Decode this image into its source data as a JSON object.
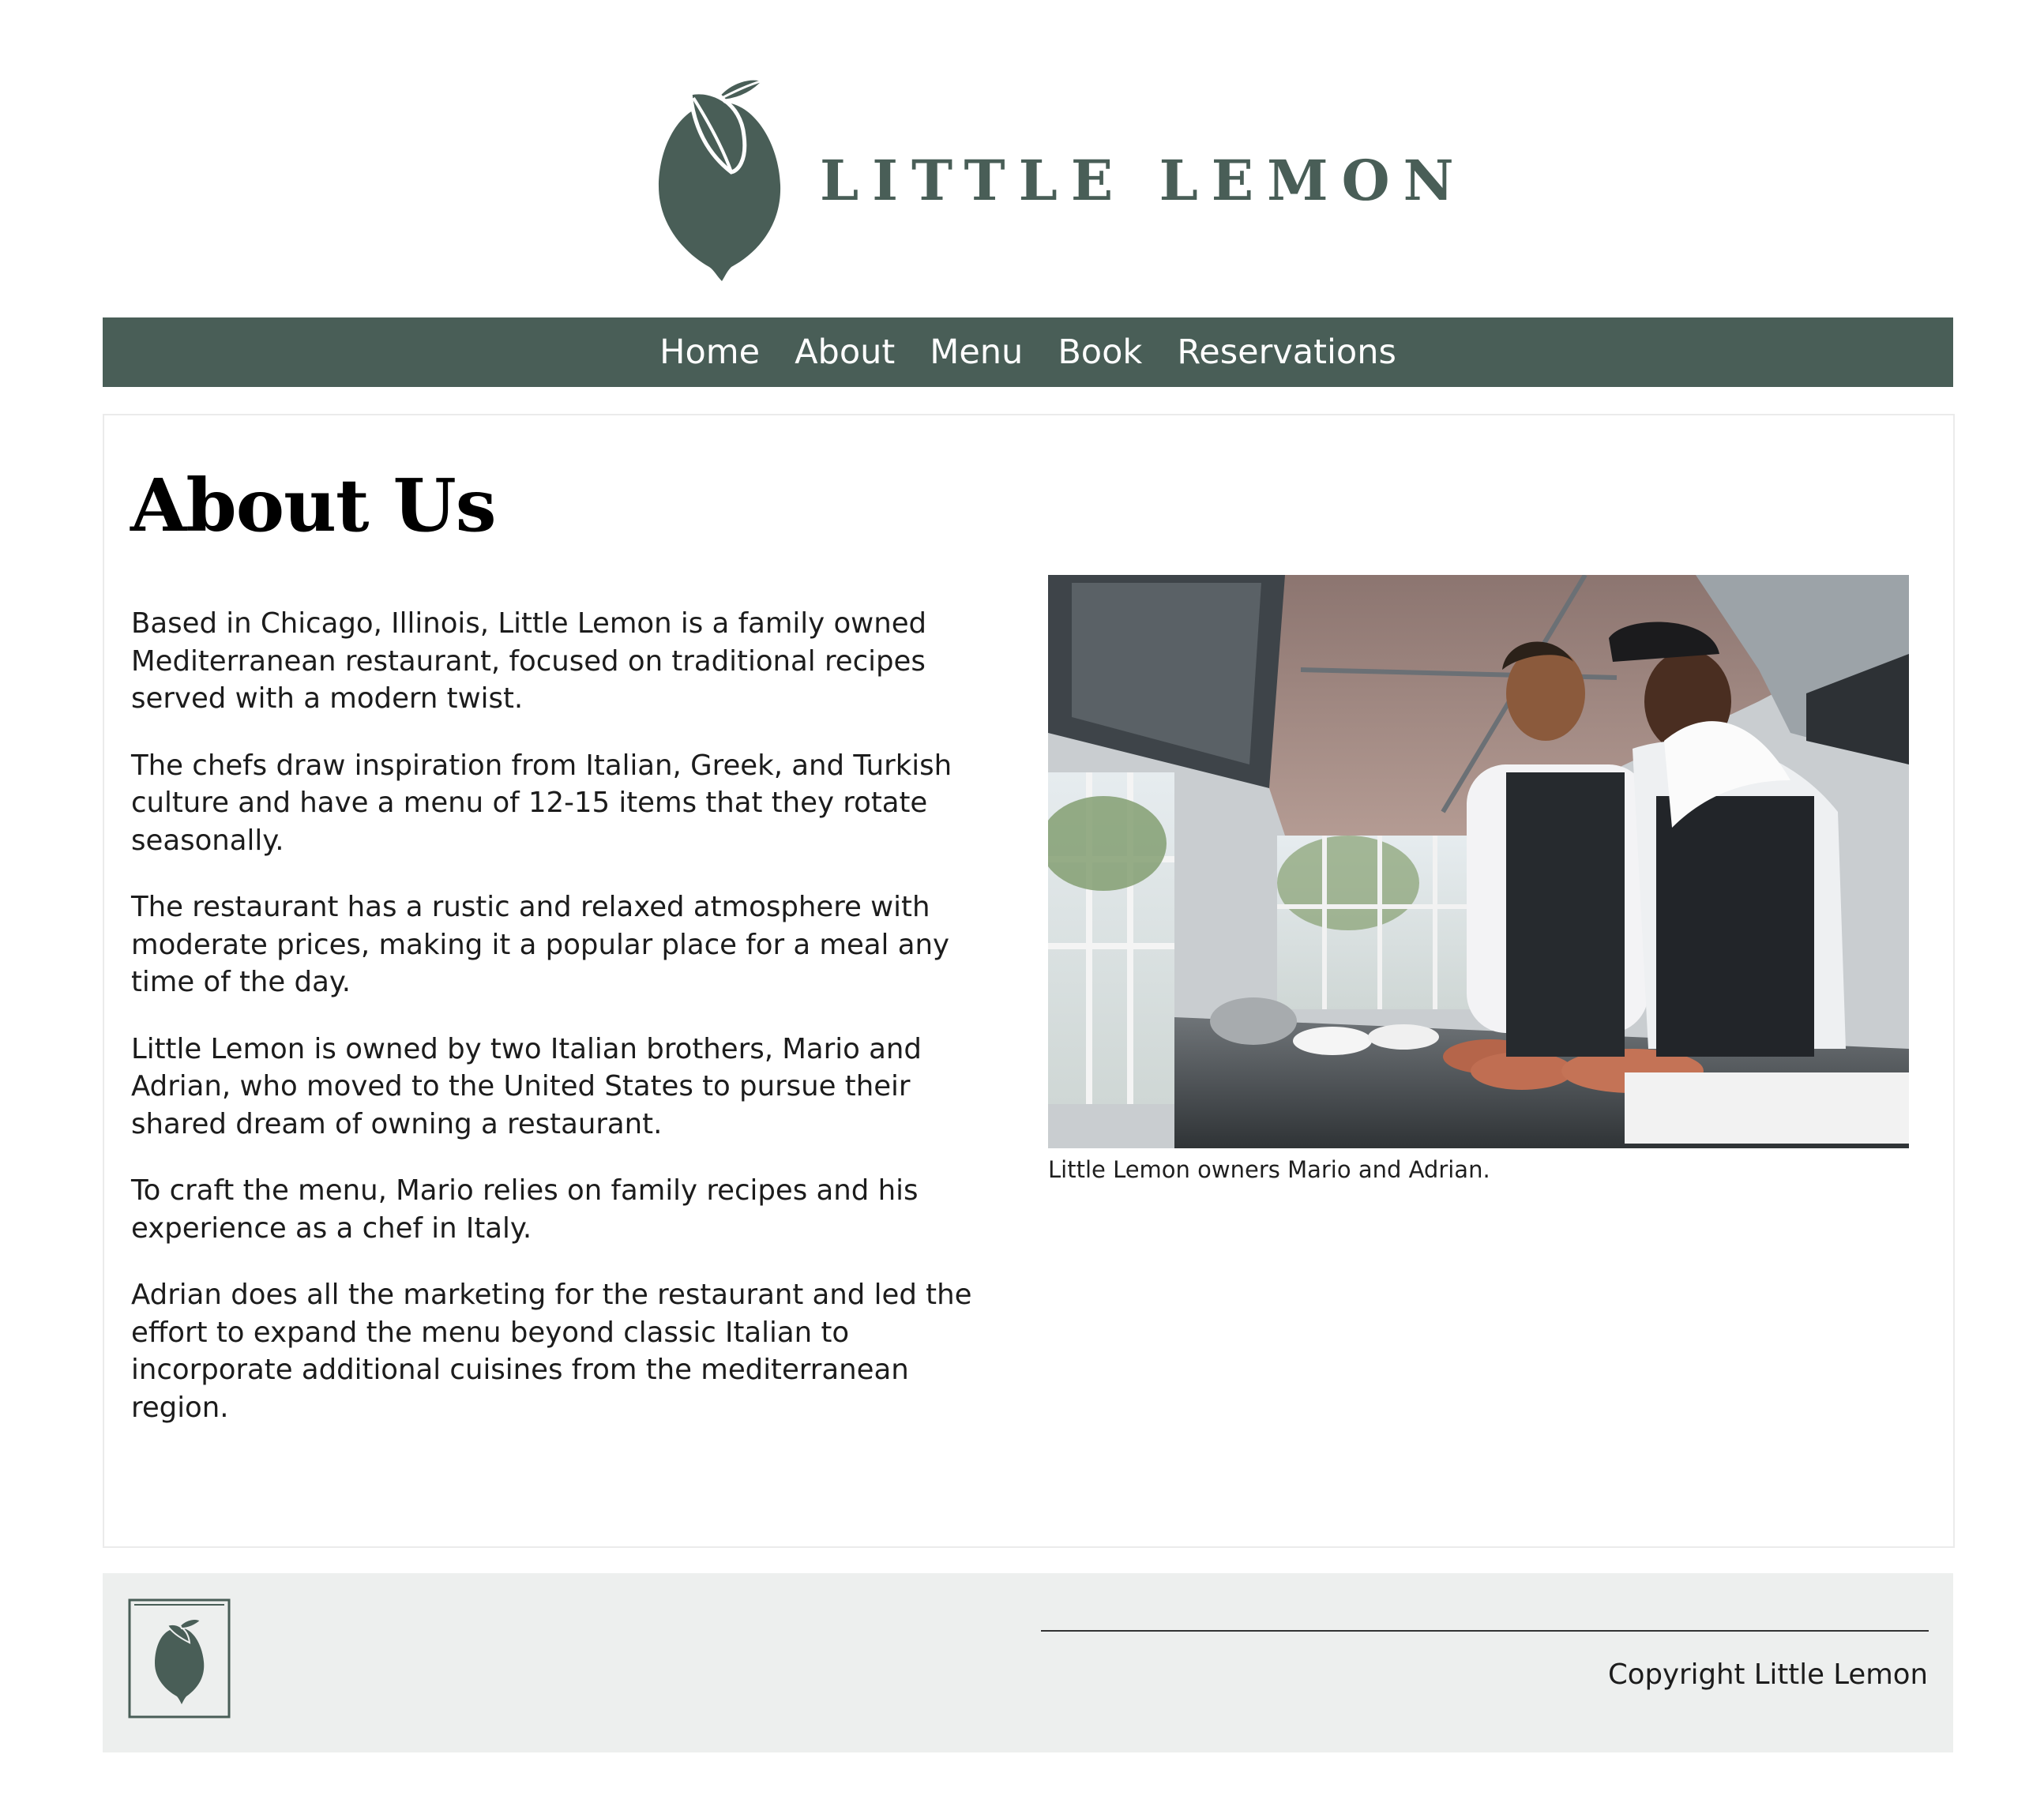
{
  "header": {
    "brand_name": "LITTLE LEMON",
    "logo_icon": "lemon-icon",
    "brand_color": "#495e57"
  },
  "nav": {
    "items": [
      {
        "label": "Home"
      },
      {
        "label": "About"
      },
      {
        "label": "Menu"
      },
      {
        "label": "Book"
      },
      {
        "label": "Reservations"
      }
    ],
    "background": "#495e57",
    "text_color": "#ffffff"
  },
  "main": {
    "title": "About Us",
    "paragraphs": [
      "Based in Chicago, Illinois, Little Lemon is a family owned Mediterranean restaurant, focused on traditional recipes served with a modern twist.",
      "The chefs draw inspiration from Italian, Greek, and Turkish culture and have a menu of 12-15 items that they rotate seasonally.",
      "The restaurant has a rustic and relaxed atmosphere with moderate prices, making it a popular place for a meal any time of the day.",
      "Little Lemon is owned by two Italian brothers, Mario and Adrian, who moved to the United States to pursue their shared dream of owning a restaurant.",
      "To craft the menu, Mario relies on family recipes and his experience as a chef in Italy.",
      "Adrian does all the marketing for the restaurant and led the effort to expand the menu beyond classic Italian to incorporate additional cuisines from the mediterranean region."
    ],
    "photo": {
      "alt": "Little Lemon owners Mario and Adrian.",
      "caption": "Little Lemon owners Mario and Adrian."
    }
  },
  "footer": {
    "logo_icon": "lemon-icon",
    "copyright": "Copyright Little Lemon",
    "background": "#edefee"
  }
}
